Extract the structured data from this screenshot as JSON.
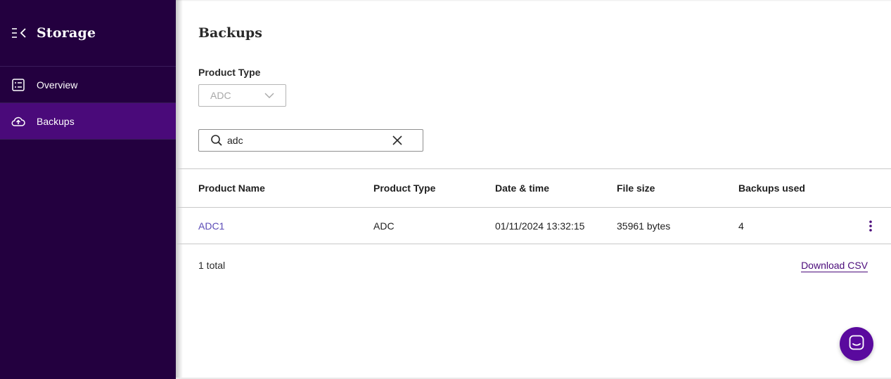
{
  "sidebar": {
    "title": "Storage",
    "items": [
      {
        "label": "Overview",
        "icon": "list-icon",
        "active": false
      },
      {
        "label": "Backups",
        "icon": "cloud-upload-icon",
        "active": true
      }
    ]
  },
  "page": {
    "title": "Backups"
  },
  "filter": {
    "label": "Product Type",
    "selected": "ADC"
  },
  "search": {
    "value": "adc"
  },
  "table": {
    "headers": [
      "Product Name",
      "Product Type",
      "Date & time",
      "File size",
      "Backups used"
    ],
    "rows": [
      {
        "name": "ADC1",
        "type": "ADC",
        "datetime": "01/11/2024 13:32:15",
        "size": "35961 bytes",
        "used": "4"
      }
    ]
  },
  "footer": {
    "total": "1 total",
    "download": "Download CSV"
  },
  "colors": {
    "sidebar_bg": "#23003f",
    "sidebar_active": "#4a0a7a",
    "accent": "#5a0a9e",
    "link": "#5b4bb6"
  }
}
